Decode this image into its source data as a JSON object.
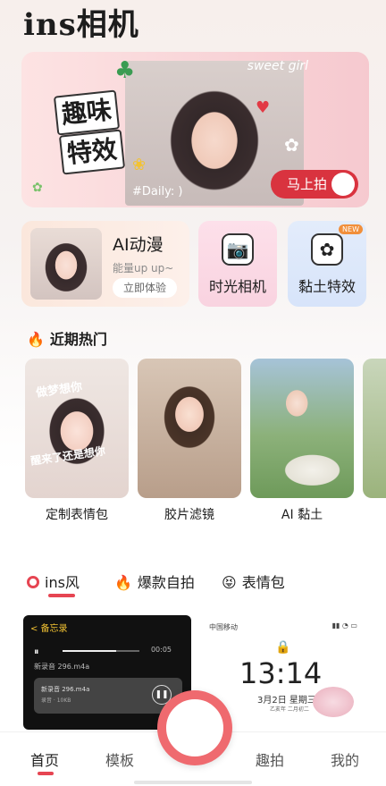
{
  "app": {
    "title": "ins相机"
  },
  "hero": {
    "sticker_line1": "趣味",
    "sticker_line2": "特效",
    "watermark": "sweet girl",
    "tag": "#Daily: )",
    "shoot_button": "马上拍",
    "accent_color": "#d9333f"
  },
  "features": {
    "ai": {
      "title": "AI动漫",
      "subtitle": "能量up up~",
      "try_button": "立即体验"
    },
    "cards": [
      {
        "label": "时光相机",
        "icon": "camera-icon"
      },
      {
        "label": "黏土特效",
        "icon": "flower-icon",
        "badge": "NEW"
      }
    ]
  },
  "hot": {
    "title": "近期热门",
    "items": [
      {
        "caption": "定制表情包",
        "overlay_top": "做梦想你",
        "overlay_bottom": "醒来了还是想你"
      },
      {
        "caption": "胶片滤镜"
      },
      {
        "caption": "AI 黏土"
      },
      {
        "caption": ""
      }
    ]
  },
  "tabs": [
    {
      "label": "ins风",
      "icon": "ring-icon",
      "active": true
    },
    {
      "label": "爆款自拍",
      "icon": "fire-icon",
      "active": false
    },
    {
      "label": "表情包",
      "icon": "smile-icon",
      "active": false
    }
  ],
  "preview_left": {
    "back": "< 备忘录",
    "file": "新录音 296.m4a",
    "time": "00:05",
    "card_title": "新录音 296.m4a",
    "card_sub": "录音 · 10KB"
  },
  "preview_right": {
    "carrier": "中国移动",
    "clock": "13:14",
    "date": "3月2日 星期三",
    "lunar": "乙亥年 二月初二"
  },
  "nav": {
    "items": [
      {
        "label": "首页",
        "active": true
      },
      {
        "label": "模板",
        "active": false
      },
      {
        "label": "趣拍",
        "active": false
      },
      {
        "label": "我的",
        "active": false
      }
    ]
  }
}
